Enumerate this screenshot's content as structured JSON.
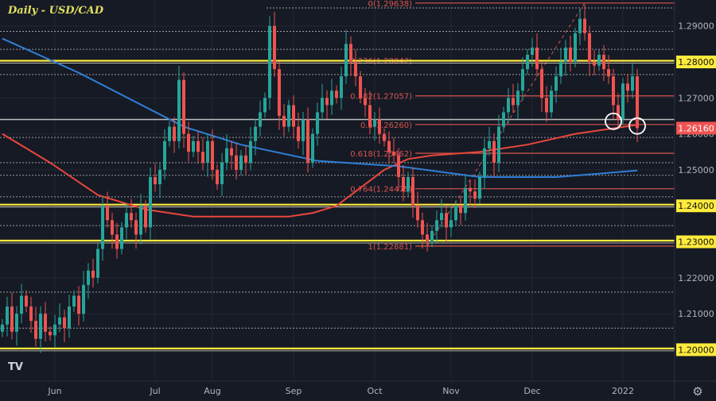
{
  "title": "Daily - USD/CAD",
  "logo": "TV",
  "settings_icon": "gear-icon",
  "colors": {
    "bg": "#161a25",
    "grid": "#232734",
    "up": "#26a69a",
    "down": "#ef5350",
    "support": "#ffeb3b",
    "fib": "#d9534f",
    "ma_fast": "#e8473c",
    "ma_slow": "#2f7fd6",
    "axis_text": "#b2b5be"
  },
  "chart_data": {
    "type": "candlestick",
    "symbol": "USD/CAD",
    "timeframe": "Daily",
    "ylim": [
      1.195,
      1.2985
    ],
    "y_ticks": [
      "1.29000",
      "1.28000",
      "1.27000",
      "1.26000",
      "1.25000",
      "1.24000",
      "1.23000",
      "1.22000",
      "1.21000",
      "1.20000"
    ],
    "y_tick_values": [
      1.29,
      1.28,
      1.27,
      1.26,
      1.25,
      1.24,
      1.23,
      1.22,
      1.21,
      1.2
    ],
    "x_ticks": [
      {
        "label": "Jun",
        "index": 11
      },
      {
        "label": "Jul",
        "index": 32
      },
      {
        "label": "Aug",
        "index": 44
      },
      {
        "label": "Sep",
        "index": 61
      },
      {
        "label": "Oct",
        "index": 78
      },
      {
        "label": "Nov",
        "index": 94
      },
      {
        "label": "Dec",
        "index": 111
      },
      {
        "label": "2022",
        "index": 130
      }
    ],
    "closes": [
      1.207,
      1.212,
      1.205,
      1.21,
      1.215,
      1.212,
      1.208,
      1.203,
      1.21,
      1.205,
      1.204,
      1.207,
      1.209,
      1.206,
      1.212,
      1.215,
      1.21,
      1.218,
      1.222,
      1.22,
      1.228,
      1.24,
      1.236,
      1.232,
      1.228,
      1.234,
      1.238,
      1.236,
      1.232,
      1.24,
      1.234,
      1.248,
      1.246,
      1.25,
      1.258,
      1.262,
      1.258,
      1.275,
      1.26,
      1.255,
      1.258,
      1.255,
      1.252,
      1.258,
      1.25,
      1.246,
      1.252,
      1.256,
      1.254,
      1.25,
      1.254,
      1.252,
      1.258,
      1.262,
      1.266,
      1.27,
      1.29,
      1.278,
      1.265,
      1.262,
      1.268,
      1.262,
      1.258,
      1.264,
      1.252,
      1.26,
      1.266,
      1.27,
      1.268,
      1.272,
      1.27,
      1.276,
      1.285,
      1.28,
      1.276,
      1.27,
      1.268,
      1.262,
      1.264,
      1.26,
      1.258,
      1.255,
      1.254,
      1.248,
      1.244,
      1.248,
      1.24,
      1.236,
      1.232,
      1.23,
      1.233,
      1.236,
      1.238,
      1.234,
      1.236,
      1.24,
      1.238,
      1.245,
      1.244,
      1.242,
      1.248,
      1.256,
      1.258,
      1.252,
      1.262,
      1.266,
      1.27,
      1.268,
      1.272,
      1.278,
      1.282,
      1.284,
      1.278,
      1.27,
      1.266,
      1.272,
      1.276,
      1.28,
      1.284,
      1.28,
      1.288,
      1.292,
      1.288,
      1.28,
      1.279,
      1.282,
      1.278,
      1.276,
      1.268,
      1.264,
      1.274,
      1.272,
      1.276,
      1.2616
    ],
    "moving_averages": [
      {
        "name": "MA fast (red)",
        "points": [
          [
            0,
            1.26
          ],
          [
            10,
            1.252
          ],
          [
            20,
            1.243
          ],
          [
            30,
            1.239
          ],
          [
            40,
            1.237
          ],
          [
            50,
            1.237
          ],
          [
            60,
            1.237
          ],
          [
            65,
            1.238
          ],
          [
            70,
            1.24
          ],
          [
            75,
            1.245
          ],
          [
            80,
            1.25
          ],
          [
            85,
            1.253
          ],
          [
            90,
            1.254
          ],
          [
            100,
            1.255
          ],
          [
            110,
            1.257
          ],
          [
            120,
            1.26
          ],
          [
            133,
            1.2625
          ]
        ]
      },
      {
        "name": "MA slow (blue)",
        "points": [
          [
            0,
            1.2865
          ],
          [
            16,
            1.277
          ],
          [
            38,
            1.262
          ],
          [
            50,
            1.257
          ],
          [
            66,
            1.2525
          ],
          [
            83,
            1.251
          ],
          [
            100,
            1.248
          ],
          [
            116,
            1.248
          ],
          [
            133,
            1.2498
          ]
        ]
      }
    ],
    "support_resistance": [
      1.28,
      1.24,
      1.23,
      1.2
    ],
    "dotted_levels": [
      1.295,
      1.2885,
      1.2835,
      1.2765,
      1.259,
      1.252,
      1.2485,
      1.2425,
      1.2345,
      1.216,
      1.206
    ],
    "grey_level": 1.264,
    "price_labels": [
      "1.28000",
      "1.24000",
      "1.23000",
      "1.20000"
    ],
    "current_price": "1.26160",
    "current_price_value": 1.2616,
    "fibonacci": [
      {
        "label": "0(1.29638)",
        "value": 1.29638
      },
      {
        "label": "0.236(1.28042)",
        "value": 1.28042
      },
      {
        "label": "0.382(1.27057)",
        "value": 1.27057
      },
      {
        "label": "0.5(1.26260)",
        "value": 1.2626
      },
      {
        "label": "0.618(1.25462)",
        "value": 1.25462
      },
      {
        "label": "0.764(1.24475)",
        "value": 1.24475
      },
      {
        "label": "1(1.22881)",
        "value": 1.22881
      }
    ],
    "fib_trend": [
      [
        89,
        1.2288
      ],
      [
        122,
        1.29638
      ]
    ],
    "highlight_circles": [
      [
        128,
        1.2635
      ],
      [
        133,
        1.2622
      ]
    ]
  }
}
